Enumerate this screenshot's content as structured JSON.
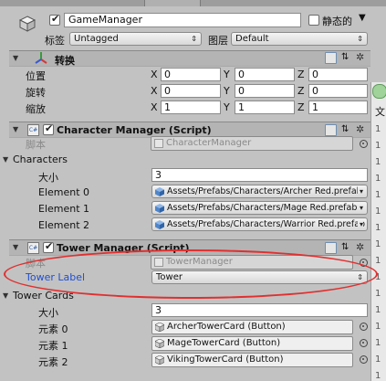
{
  "gameobject": {
    "name": "GameManager",
    "static_label": "静态的",
    "tag_label": "标签",
    "tag_value": "Untagged",
    "layer_label": "图层",
    "layer_value": "Default"
  },
  "transform": {
    "title": "转换",
    "position_label": "位置",
    "rotation_label": "旋转",
    "scale_label": "缩放",
    "x": "X",
    "y": "Y",
    "z": "Z",
    "position": [
      "0",
      "0",
      "0"
    ],
    "rotation": [
      "0",
      "0",
      "0"
    ],
    "scale": [
      "1",
      "1",
      "1"
    ]
  },
  "character_manager": {
    "title": "Character Manager (Script)",
    "script_label": "脚本",
    "script_value": "CharacterManager",
    "list_label": "Characters",
    "size_label": "大小",
    "size_value": "3",
    "elements": [
      {
        "label": "Element 0",
        "value": "Assets/Prefabs/Characters/Archer Red.prefab"
      },
      {
        "label": "Element 1",
        "value": "Assets/Prefabs/Characters/Mage Red.prefab"
      },
      {
        "label": "Element 2",
        "value": "Assets/Prefabs/Characters/Warrior Red.prefab"
      }
    ]
  },
  "tower_manager": {
    "title": "Tower Manager (Script)",
    "script_label": "脚本",
    "script_value": "TowerManager",
    "tower_label_label": "Tower Label",
    "tower_label_value": "Tower",
    "list_label": "Tower Cards",
    "size_label": "大小",
    "size_value": "3",
    "elements": [
      {
        "label": "元素 0",
        "value": "ArcherTowerCard (Button)"
      },
      {
        "label": "元素 1",
        "value": "MageTowerCard (Button)"
      },
      {
        "label": "元素 2",
        "value": "VikingTowerCard (Button)"
      }
    ]
  },
  "right_panel": {
    "text_fragment": "文",
    "line_digits": [
      "1",
      "1",
      "1",
      "1",
      "1",
      "1",
      "1",
      "1",
      "1",
      "1",
      "1",
      "1",
      "1",
      "1",
      "1",
      "1"
    ]
  },
  "colors": {
    "highlight_ellipse": "#e03030",
    "modified_label_blue": "#1f4fd1"
  }
}
